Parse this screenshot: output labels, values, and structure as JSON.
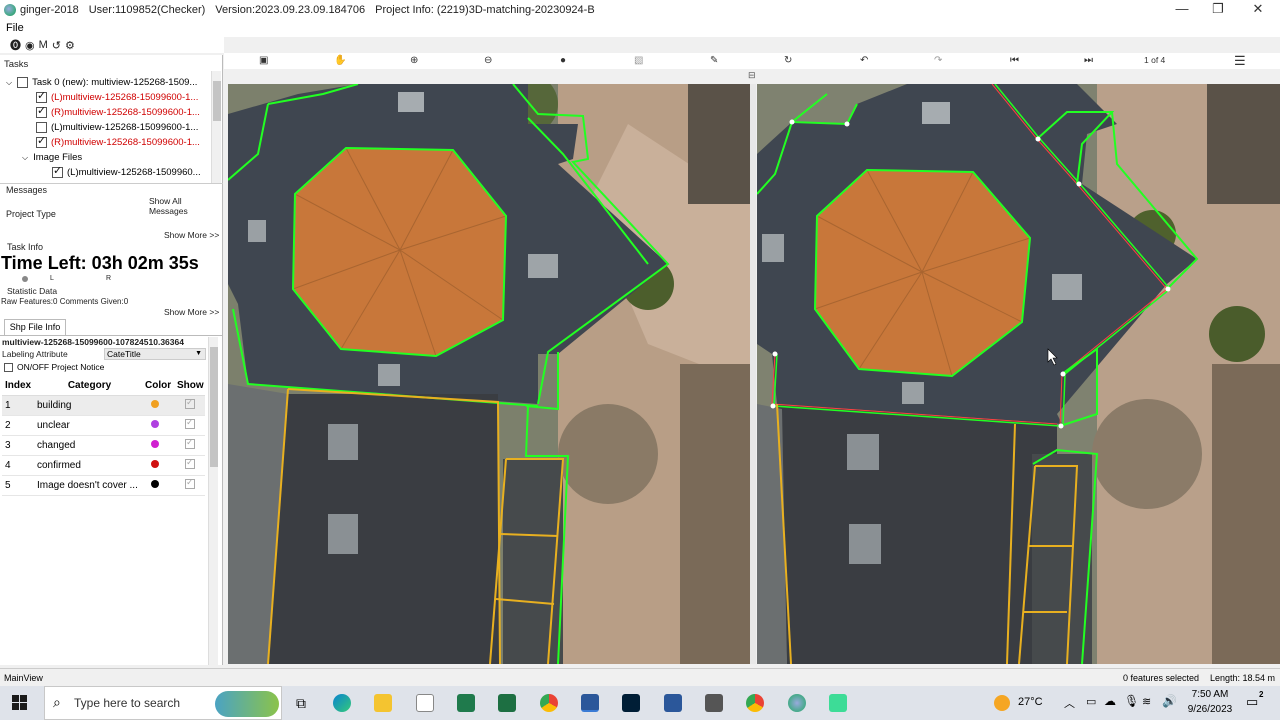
{
  "window": {
    "app": "ginger-2018",
    "user": "User:1109852(Checker)",
    "version": "Version:2023.09.23.09.184706",
    "project": "Project Info: (2219)3D-matching-20230924-B"
  },
  "menu": {
    "file": "File"
  },
  "mini_toolbar": {
    "m_label": "M"
  },
  "tasks": {
    "header": "Tasks",
    "root": "Task 0 (new): multiview-125268-1509...",
    "items": [
      {
        "label": "(L)multiview-125268-15099600-1...",
        "checked": true,
        "red": true
      },
      {
        "label": "(R)multiview-125268-15099600-1...",
        "checked": true,
        "red": true
      },
      {
        "label": "(L)multiview-125268-15099600-1...",
        "checked": false,
        "red": false
      },
      {
        "label": "(R)multiview-125268-15099600-1...",
        "checked": true,
        "red": true
      }
    ],
    "image_files": "Image Files",
    "image_child": "(L)multiview-125268-1509960..."
  },
  "messages": {
    "header": "Messages",
    "show_all": "Show All Messages"
  },
  "project_type": {
    "header": "Project Type",
    "show_more": "Show More >>"
  },
  "task_info": {
    "header": "Task Info",
    "time_left": "Time Left: 03h 02m 35s",
    "lr_l": "L",
    "lr_r": "R",
    "statistic": "Statistic Data",
    "raw": "Raw Features:0 Comments Given:0",
    "show_more": "Show More >>"
  },
  "shp": {
    "tab": "Shp File Info",
    "file": "multiview-125268-15099600-107824510.36364",
    "labeling_label": "Labeling Attribute",
    "labeling_value": "CateTitle",
    "notice": "ON/OFF Project Notice",
    "columns": [
      "Index",
      "Category",
      "Color",
      "Show"
    ],
    "rows": [
      {
        "index": "1",
        "category": "building",
        "color": "#f0a020"
      },
      {
        "index": "2",
        "category": "unclear",
        "color": "#b040e0"
      },
      {
        "index": "3",
        "category": "changed",
        "color": "#d020d0"
      },
      {
        "index": "4",
        "category": "confirmed",
        "color": "#d01010"
      },
      {
        "index": "5",
        "category": "Image doesn't cover ...",
        "color": "#000000"
      }
    ]
  },
  "viewer_toolbar": {
    "page": "1 of 4"
  },
  "status": {
    "left": "MainView",
    "features": "0 features selected",
    "length": "Length: 18.54 m"
  },
  "taskbar": {
    "search_placeholder": "Type here to search",
    "temperature": "27°C",
    "time": "7:50 AM",
    "date": "9/26/2023",
    "notif_count": "2"
  },
  "colors": {
    "edge_green": "#22ff22",
    "building_orange": "#e8b020",
    "roof_orange": "#c87838"
  }
}
